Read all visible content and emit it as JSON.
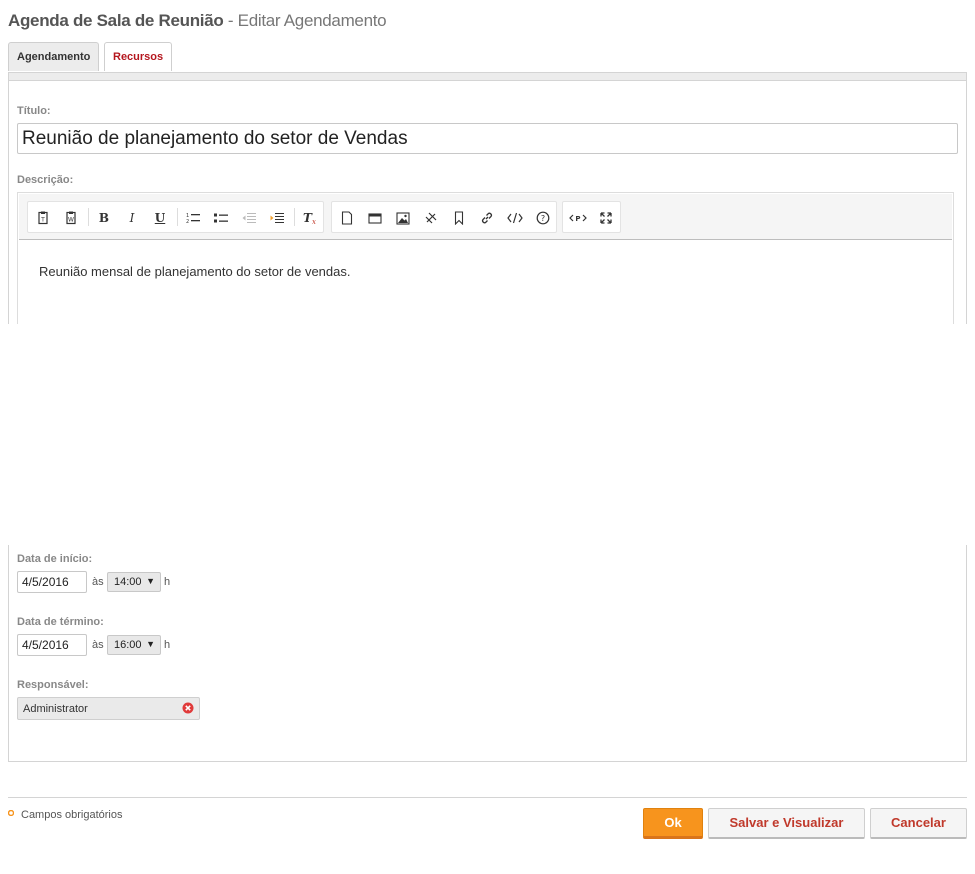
{
  "page": {
    "title_bold": "Agenda de Sala de Reunião",
    "title_rest": " - Editar Agendamento"
  },
  "tabs": [
    {
      "label": "Agendamento",
      "active": true
    },
    {
      "label": "Recursos",
      "active": false
    }
  ],
  "form": {
    "title_label": "Título:",
    "title_value": "Reunião de planejamento do setor de Vendas",
    "description_label": "Descrição:",
    "description_text": "Reunião mensal de planejamento do setor de vendas.",
    "start_label": "Data de início:",
    "start_date": "4/5/2016",
    "start_time": "14:00",
    "end_label": "Data de término:",
    "end_date": "4/5/2016",
    "end_time": "16:00",
    "at_label": "às",
    "hour_suffix": "h",
    "responsible_label": "Responsável:",
    "responsible_value": "Administrator"
  },
  "toolbar_icons": [
    "paste-text-icon",
    "paste-word-icon",
    "bold-icon",
    "italic-icon",
    "underline-icon",
    "numbered-list-icon",
    "bulleted-list-icon",
    "outdent-icon",
    "indent-icon",
    "remove-format-icon",
    "new-page-icon",
    "browse-icon",
    "image-icon",
    "insert-special-icon",
    "anchor-icon",
    "link-icon",
    "code-icon",
    "about-icon",
    "source-icon",
    "maximize-icon"
  ],
  "footer": {
    "required_note": "Campos obrigatórios",
    "ok_label": "Ok",
    "save_view_label": "Salvar e Visualizar",
    "cancel_label": "Cancelar"
  },
  "colors": {
    "accent_orange": "#f7941d",
    "tab_link_red": "#b5161e",
    "button_text_red": "#c0392b"
  }
}
